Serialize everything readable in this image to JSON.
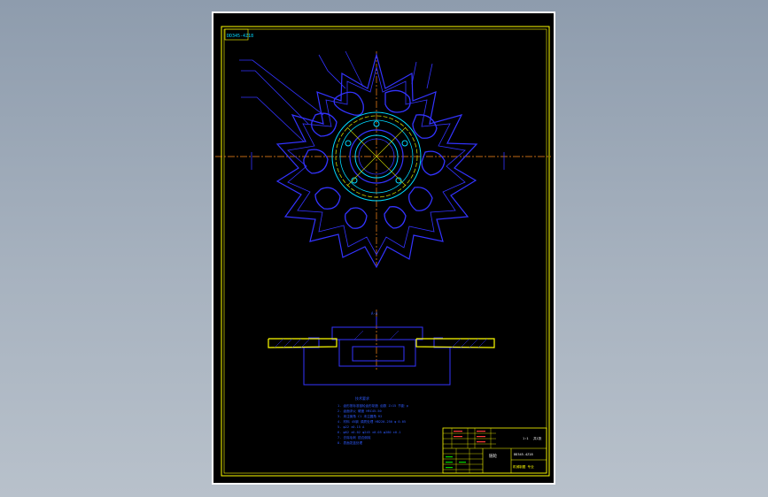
{
  "drawing": {
    "code_label": "DD345-4Z18",
    "section_label": "A-A",
    "notes_title": "技术要求",
    "notes_lines": [
      "1. 齿形按标准链轮齿形制造 齿数 Z=15 节距 p",
      "2. 齿面淬火 硬度 HRC45-50",
      "3. 未注倒角 C1 未注圆角 R2",
      "4. 材料 45钢 调质处理 HB220-250 φ 0.05",
      "5. φ22 ±0.15 A",
      "6. φ62 ±0.02 φ245 ±0.05 φ280 ±0.1",
      "7. 去除毛刺 锐边倒钝",
      "8. 表面发蓝处理"
    ],
    "title_block": {
      "part_name": "链轮",
      "drawing_no": "DD345-4Z18",
      "company": "机械制图 专业",
      "scale": "1:1",
      "sheet": "共1张"
    }
  },
  "colors": {
    "page_bg": "#a7b2bf",
    "sheet_bg": "#000000",
    "frame": "#ffff00",
    "outline": "#3333ff",
    "centerline": "#ff8c1a",
    "hole_circle": "#00d7ff",
    "bolt_circle": "#c8d200",
    "notes_text": "#2f5bff"
  }
}
